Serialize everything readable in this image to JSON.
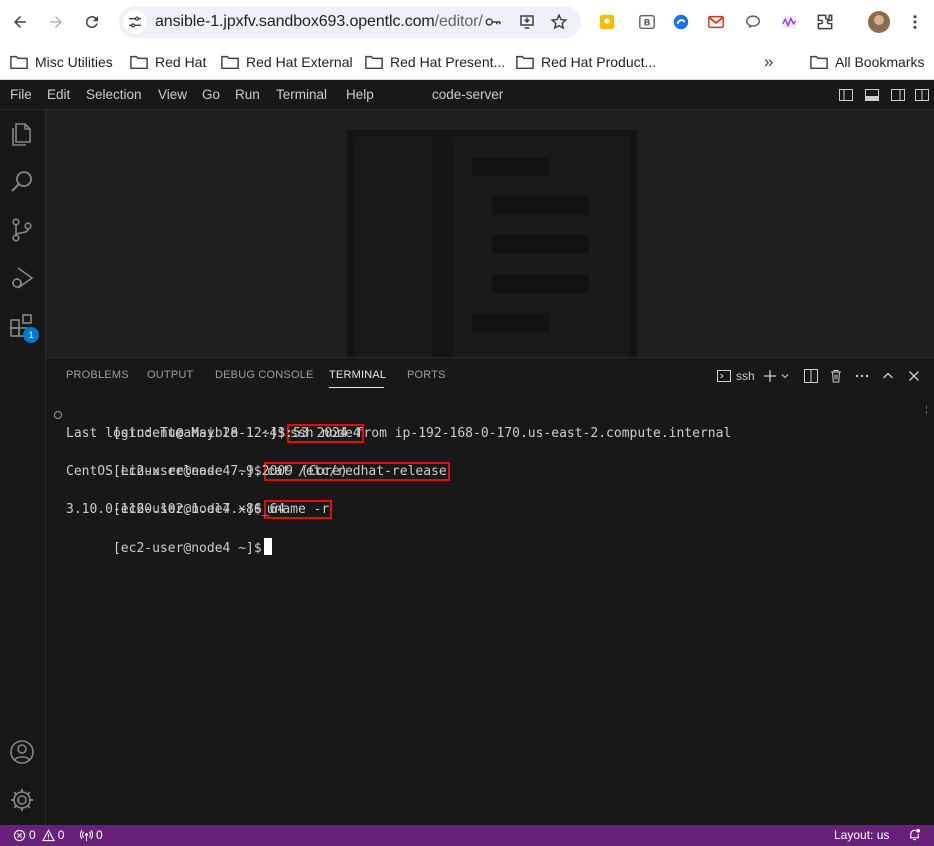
{
  "browser": {
    "url_host": "ansible-1.jpxfv.sandbox693.opentlc.com",
    "url_path": "/editor/",
    "bookmarks": [
      "Misc Utilities",
      "Red Hat",
      "Red Hat External",
      "Red Hat Present...",
      "Red Hat Product...",
      "All Bookmarks"
    ],
    "overflow_glyph": "»"
  },
  "menubar": {
    "items": [
      "File",
      "Edit",
      "Selection",
      "View",
      "Go",
      "Run",
      "Terminal",
      "Help"
    ],
    "title": "code-server"
  },
  "activity": {
    "extensions_badge": "1"
  },
  "panel": {
    "tabs": [
      "PROBLEMS",
      "OUTPUT",
      "DEBUG CONSOLE",
      "TERMINAL",
      "PORTS"
    ],
    "active_tab": "TERMINAL",
    "terminal_name": "ssh"
  },
  "terminal": {
    "lines": [
      {
        "prompt": "[student@ansible-1 ~]$",
        "cmd": "ssh node4"
      },
      {
        "text": "Last login: Tue May 28 12:43:53 2024 from ip-192-168-0-170.us-east-2.compute.internal"
      },
      {
        "prompt": "[ec2-user@node4 ~]$",
        "cmd": "cat /etc/redhat-release"
      },
      {
        "text": "CentOS Linux release 7.9.2009 (Core)"
      },
      {
        "prompt": "[ec2-user@node4 ~]$",
        "cmd": "uname -r"
      },
      {
        "text": "3.10.0-1160.102.1.el7.x86_64"
      },
      {
        "prompt": "[ec2-user@node4 ~]$"
      }
    ]
  },
  "statusbar": {
    "errors": "0",
    "warnings": "0",
    "ports": "0",
    "layout": "Layout: us"
  },
  "colors": {
    "status_bar": "#68217a",
    "highlight_box": "#e30d0d",
    "badge": "#0078d4"
  }
}
